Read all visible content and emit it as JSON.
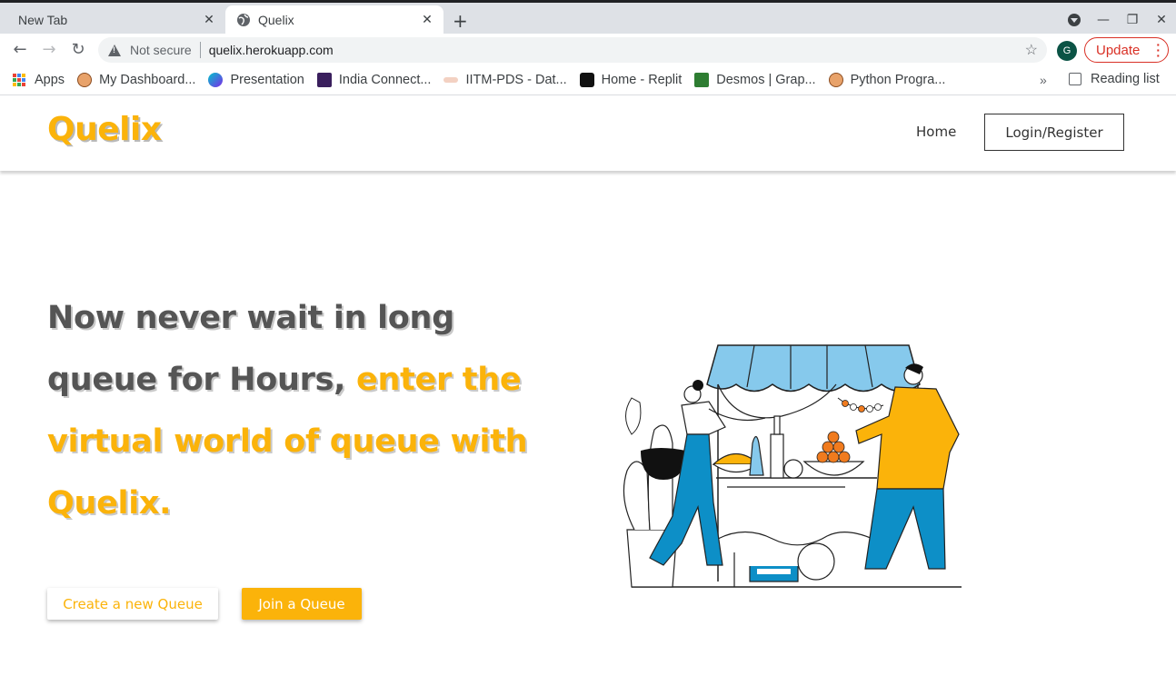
{
  "browser": {
    "tabs": [
      {
        "title": "New Tab",
        "active": false
      },
      {
        "title": "Quelix",
        "active": true
      }
    ],
    "address": {
      "security_label": "Not secure",
      "url": "quelix.herokuapp.com"
    },
    "profile_initial": "G",
    "update_label": "Update",
    "bookmarks": [
      {
        "label": "Apps",
        "icon": "apps-grid-icon"
      },
      {
        "label": "My Dashboard...",
        "icon": "avatar-icon"
      },
      {
        "label": "Presentation",
        "icon": "canva-icon"
      },
      {
        "label": "India Connect...",
        "icon": "ntu-icon"
      },
      {
        "label": "IITM-PDS - Dat...",
        "icon": "iitm-icon"
      },
      {
        "label": "Home - Replit",
        "icon": "replit-icon"
      },
      {
        "label": "Desmos | Grap...",
        "icon": "desmos-icon"
      },
      {
        "label": "Python Progra...",
        "icon": "avatar-icon"
      }
    ],
    "reading_list": "Reading list"
  },
  "site": {
    "logo": "Quelix",
    "nav": {
      "home": "Home",
      "login": "Login/Register"
    },
    "hero": {
      "headline_plain": "Now never wait in long queue for Hours,",
      "headline_accent": "enter the virtual world of queue with Quelix.",
      "create_button": "Create a new Queue",
      "join_button": "Join a Queue"
    }
  },
  "colors": {
    "brand": "#fbb30a",
    "headline": "#555555",
    "update_red": "#d93025",
    "illustration_blue": "#0d8fc7",
    "awning_blue": "#86c9ec"
  }
}
